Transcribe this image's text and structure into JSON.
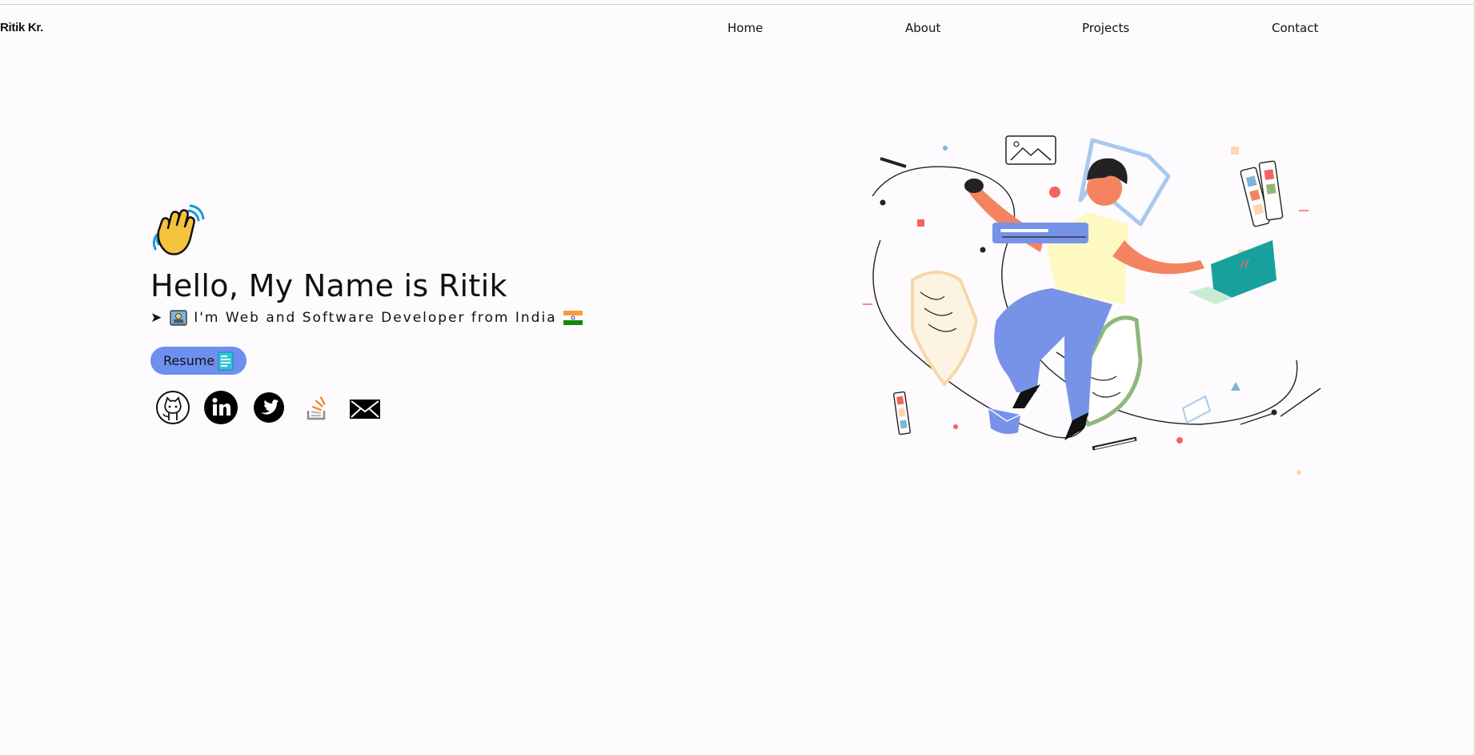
{
  "brand": "Ritik Kr.",
  "nav": [
    {
      "label": "Home"
    },
    {
      "label": "About"
    },
    {
      "label": "Projects"
    },
    {
      "label": "Contact"
    }
  ],
  "hero": {
    "greeting_icon": "waving-hand-icon",
    "title": "Hello, My Name is Ritik",
    "subtitle_arrow": "➤",
    "subtitle": "I'm Web and Software Developer from India",
    "resume_label": "Resume"
  },
  "socials": [
    {
      "icon": "github-icon"
    },
    {
      "icon": "linkedin-icon"
    },
    {
      "icon": "twitter-icon"
    },
    {
      "icon": "stackoverflow-icon"
    },
    {
      "icon": "mail-icon"
    }
  ],
  "colors": {
    "accent": "#6f8ff0",
    "background": "#fdfbfd",
    "orange": "#f4845f",
    "yellow": "#fef9c3",
    "blue": "#7793e8",
    "green": "#8fb77b",
    "teal": "#18a09c"
  }
}
